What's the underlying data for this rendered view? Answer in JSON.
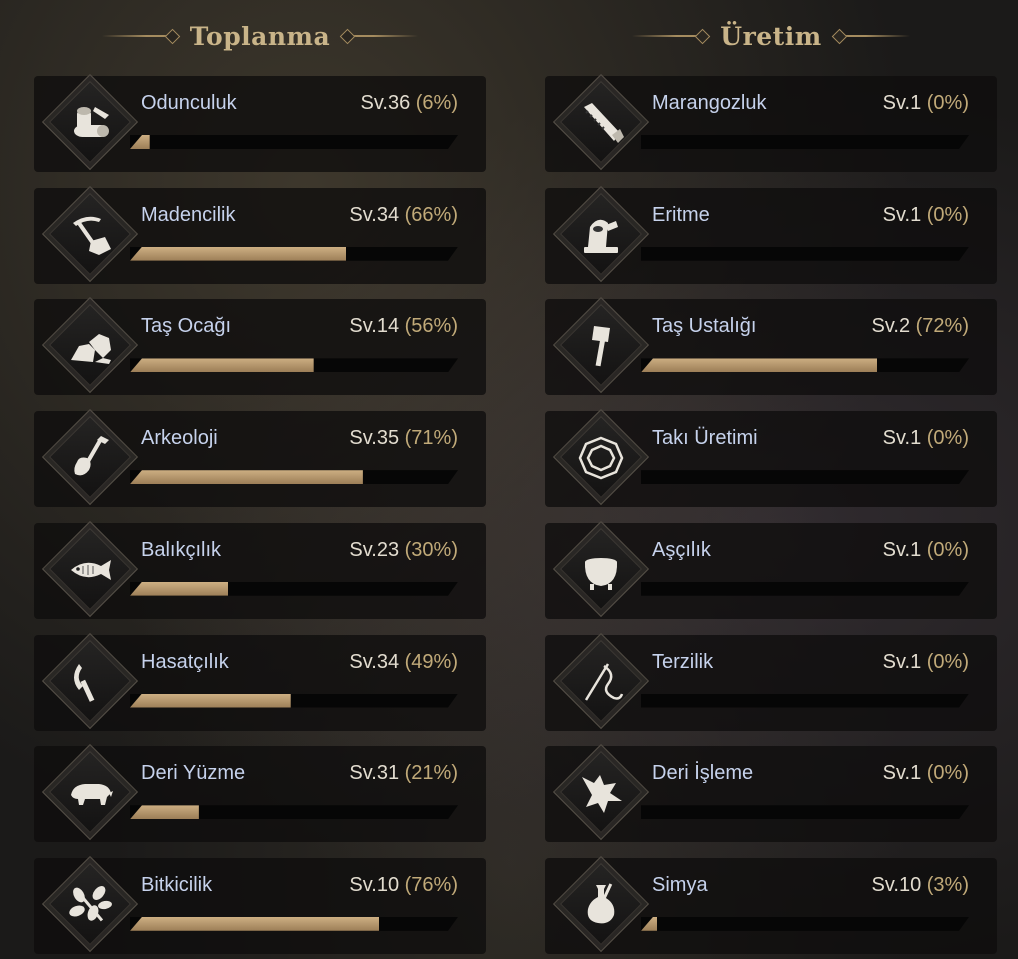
{
  "gathering": {
    "title": "Toplanma",
    "skills": [
      {
        "name": "Odunculuk",
        "level": "Sv.36",
        "percent_text": "(6%)",
        "progress": 0.06,
        "icon": "logs-icon"
      },
      {
        "name": "Madencilik",
        "level": "Sv.34",
        "percent_text": "(66%)",
        "progress": 0.66,
        "icon": "pickaxe-icon"
      },
      {
        "name": "Taş Ocağı",
        "level": "Sv.14",
        "percent_text": "(56%)",
        "progress": 0.56,
        "icon": "rocks-icon"
      },
      {
        "name": "Arkeoloji",
        "level": "Sv.35",
        "percent_text": "(71%)",
        "progress": 0.71,
        "icon": "shovel-icon"
      },
      {
        "name": "Balıkçılık",
        "level": "Sv.23",
        "percent_text": "(30%)",
        "progress": 0.3,
        "icon": "fish-icon"
      },
      {
        "name": "Hasatçılık",
        "level": "Sv.34",
        "percent_text": "(49%)",
        "progress": 0.49,
        "icon": "sickle-icon"
      },
      {
        "name": "Deri Yüzme",
        "level": "Sv.31",
        "percent_text": "(21%)",
        "progress": 0.21,
        "icon": "boar-icon"
      },
      {
        "name": "Bitkicilik",
        "level": "Sv.10",
        "percent_text": "(76%)",
        "progress": 0.76,
        "icon": "leaf-icon"
      }
    ]
  },
  "crafting": {
    "title": "Üretim",
    "skills": [
      {
        "name": "Marangozluk",
        "level": "Sv.1",
        "percent_text": "(0%)",
        "progress": 0.0,
        "icon": "saw-icon"
      },
      {
        "name": "Eritme",
        "level": "Sv.1",
        "percent_text": "(0%)",
        "progress": 0.0,
        "icon": "furnace-icon"
      },
      {
        "name": "Taş Ustalığı",
        "level": "Sv.2",
        "percent_text": "(72%)",
        "progress": 0.72,
        "icon": "hammer-icon"
      },
      {
        "name": "Takı Üretimi",
        "level": "Sv.1",
        "percent_text": "(0%)",
        "progress": 0.0,
        "icon": "gem-icon"
      },
      {
        "name": "Aşçılık",
        "level": "Sv.1",
        "percent_text": "(0%)",
        "progress": 0.0,
        "icon": "cauldron-icon"
      },
      {
        "name": "Terzilik",
        "level": "Sv.1",
        "percent_text": "(0%)",
        "progress": 0.0,
        "icon": "needle-icon"
      },
      {
        "name": "Deri İşleme",
        "level": "Sv.1",
        "percent_text": "(0%)",
        "progress": 0.0,
        "icon": "hide-icon"
      },
      {
        "name": "Simya",
        "level": "Sv.10",
        "percent_text": "(3%)",
        "progress": 0.03,
        "icon": "flask-icon"
      }
    ]
  },
  "colors": {
    "header_gold": "#c9b489",
    "skill_name": "#c6d2ec",
    "percent_gold": "#c1aa79",
    "bar_fill": "#b8996c"
  }
}
